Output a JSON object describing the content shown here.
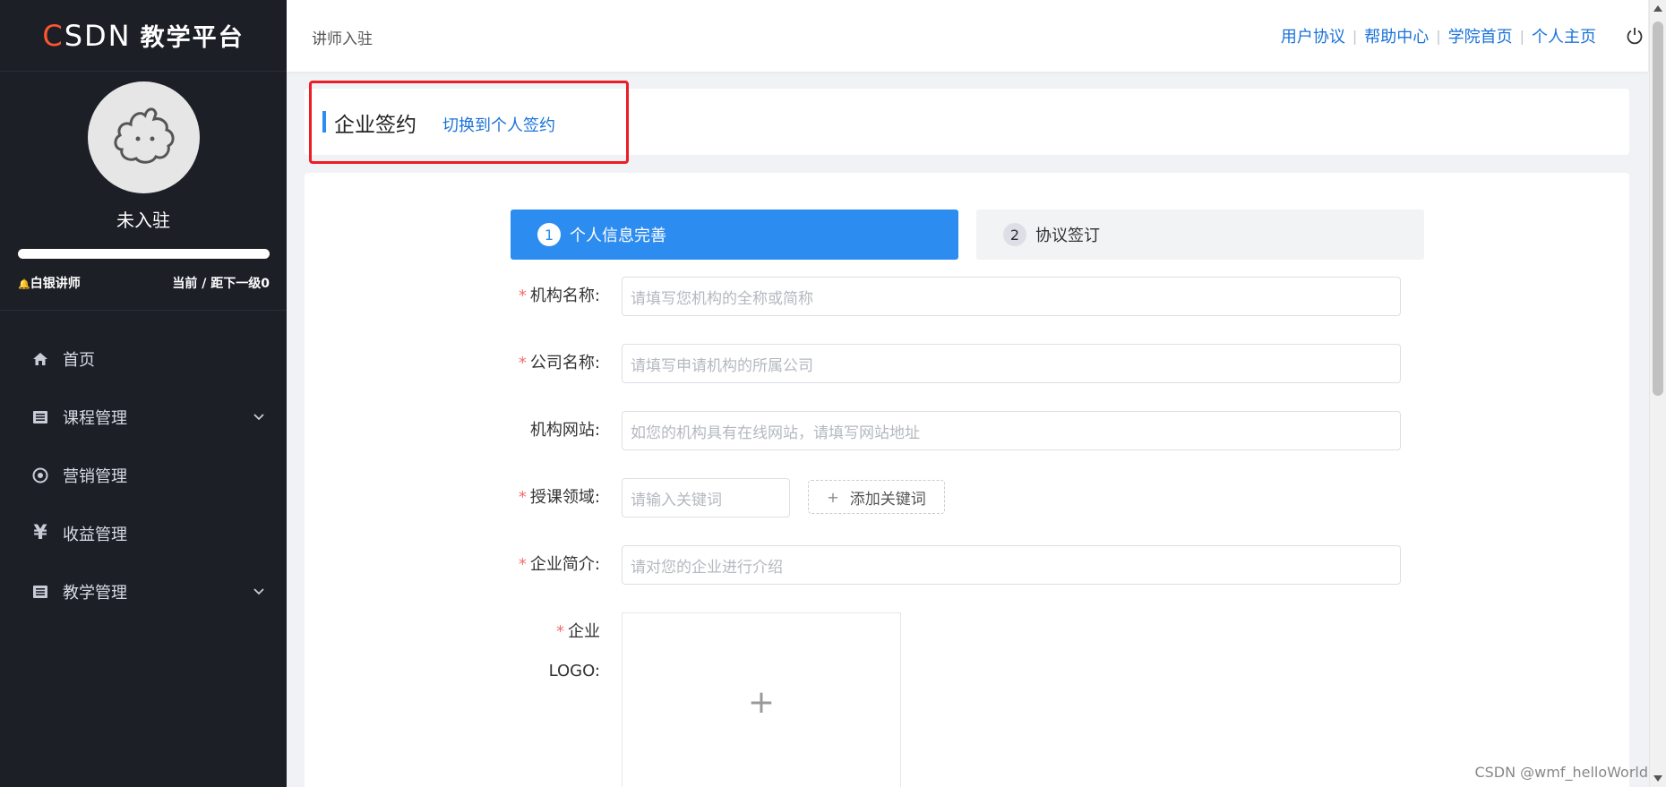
{
  "brand": {
    "csdn": "SDN",
    "csdn_c": "C",
    "platform": "教学平台"
  },
  "user": {
    "name": "未入驻",
    "level": "白银讲师",
    "progress_text": "当前 / 距下一级0",
    "progress": 1.0
  },
  "menu": [
    {
      "label": "首页",
      "icon": "home-icon"
    },
    {
      "label": "课程管理",
      "icon": "list-icon",
      "expandable": true
    },
    {
      "label": "营销管理",
      "icon": "target-icon"
    },
    {
      "label": "收益管理",
      "icon": "yen-icon"
    },
    {
      "label": "教学管理",
      "icon": "list-icon",
      "expandable": true
    }
  ],
  "header": {
    "breadcrumb": "讲师入驻",
    "links": [
      "用户协议",
      "帮助中心",
      "学院首页",
      "个人主页"
    ]
  },
  "title_card": {
    "title": "企业签约",
    "switch_link": "切换到个人签约"
  },
  "steps": [
    {
      "num": "1",
      "label": "个人信息完善",
      "active": true
    },
    {
      "num": "2",
      "label": "协议签订",
      "active": false
    }
  ],
  "form": {
    "org_name": {
      "label": "机构名称:",
      "required": true,
      "placeholder": "请填写您机构的全称或简称"
    },
    "company_name": {
      "label": "公司名称:",
      "required": true,
      "placeholder": "请填写申请机构的所属公司"
    },
    "website": {
      "label": "机构网站:",
      "required": false,
      "placeholder": "如您的机构具有在线网站，请填写网站地址"
    },
    "domain": {
      "label": "授课领域:",
      "required": true,
      "placeholder": "请输入关键词",
      "add_button": "添加关键词"
    },
    "intro": {
      "label": "企业简介:",
      "required": true,
      "placeholder": "请对您的企业进行介绍"
    },
    "logo": {
      "label": "企业LOGO:",
      "required": true,
      "upload_symbol": "+"
    }
  },
  "watermark": "CSDN @wmf_helloWorld",
  "colors": {
    "accent": "#2d8cf0",
    "link": "#1a73d9",
    "sidebar": "#1d1f27",
    "highlight": "#ee1c24"
  }
}
